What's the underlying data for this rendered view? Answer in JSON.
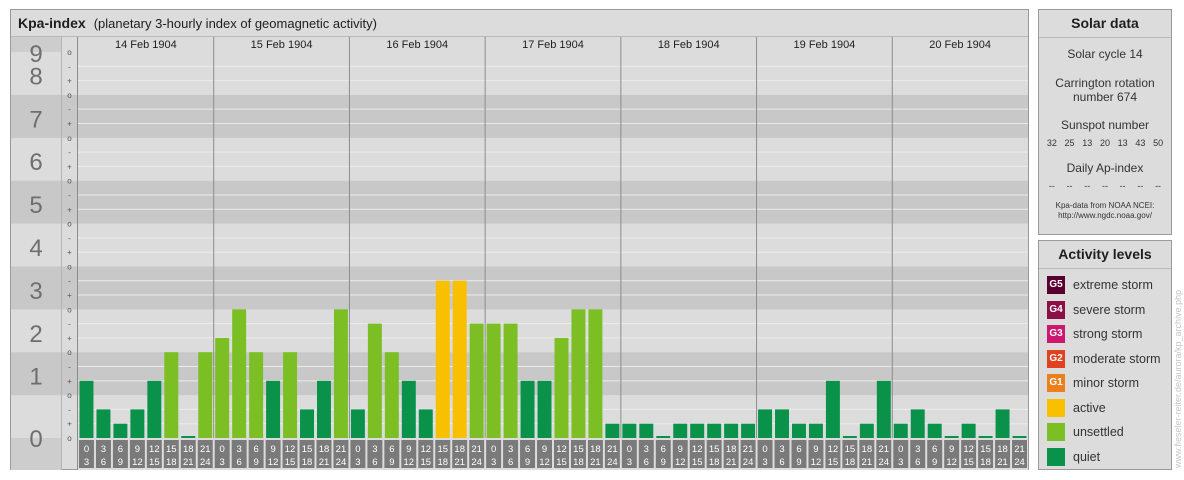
{
  "header": {
    "title": "Kpa-index",
    "subtitle": "(planetary 3-hourly index of geomagnetic activity)"
  },
  "chart_data": {
    "type": "bar",
    "ylim": [
      0,
      9
    ],
    "y_ticks": [
      "0",
      "1",
      "2",
      "3",
      "4",
      "5",
      "6",
      "7",
      "8",
      "9"
    ],
    "minor_ticks": [
      "o",
      "+",
      "-",
      "o"
    ],
    "days": [
      "14 Feb 1904",
      "15 Feb 1904",
      "16 Feb 1904",
      "17 Feb 1904",
      "18 Feb 1904",
      "19 Feb 1904",
      "20 Feb 1904"
    ],
    "slots": [
      [
        "0",
        "3"
      ],
      [
        "3",
        "6"
      ],
      [
        "6",
        "9"
      ],
      [
        "9",
        "12"
      ],
      [
        "12",
        "15"
      ],
      [
        "15",
        "18"
      ],
      [
        "18",
        "21"
      ],
      [
        "21",
        "24"
      ]
    ],
    "values": [
      1.333,
      0.667,
      0.333,
      0.667,
      1.333,
      2,
      0,
      2,
      2.333,
      3,
      2,
      1.333,
      2,
      0.667,
      1.333,
      3,
      0.667,
      2.667,
      2,
      1.333,
      0.667,
      3.667,
      3.667,
      2.667,
      2.667,
      2.667,
      1.333,
      1.333,
      2.333,
      3,
      3,
      0.333,
      0.333,
      0.333,
      0,
      0.333,
      0.333,
      0.333,
      0.333,
      0.333,
      0.667,
      0.667,
      0.333,
      0.333,
      1.333,
      0,
      0.333,
      1.333,
      0.333,
      0.667,
      0.333,
      0,
      0.333,
      0,
      0.667,
      0
    ],
    "level_colors": {
      "quiet": "#0a924a",
      "unsettled": "#7bbf25",
      "active": "#f8c000"
    }
  },
  "solar": {
    "title": "Solar data",
    "cycle": "Solar cycle 14",
    "carrington_1": "Carrington rotation",
    "carrington_2": "number 674",
    "sunspot_title": "Sunspot number",
    "sunspots": [
      "32",
      "25",
      "13",
      "20",
      "13",
      "43",
      "50"
    ],
    "ap_title": "Daily Ap-index",
    "ap": [
      "--",
      "--",
      "--",
      "--",
      "--",
      "--",
      "--"
    ],
    "note_1": "Kpa-data from NOAA NCEI:",
    "note_2": "http://www.ngdc.noaa.gov/"
  },
  "levels": {
    "title": "Activity levels",
    "items": [
      {
        "badge": "G5",
        "label": "extreme storm",
        "color": "#5a0030"
      },
      {
        "badge": "G4",
        "label": "severe storm",
        "color": "#8c1046"
      },
      {
        "badge": "G3",
        "label": "strong storm",
        "color": "#cc1670"
      },
      {
        "badge": "G2",
        "label": "moderate storm",
        "color": "#e2401e"
      },
      {
        "badge": "G1",
        "label": "minor storm",
        "color": "#e9801c"
      },
      {
        "badge": "",
        "label": "active",
        "color": "#f8c000"
      },
      {
        "badge": "",
        "label": "unsettled",
        "color": "#7bbf25"
      },
      {
        "badge": "",
        "label": "quiet",
        "color": "#0a924a"
      }
    ]
  },
  "credit": "www.fieseler-reiter.de/aurora/kp_archive.php"
}
